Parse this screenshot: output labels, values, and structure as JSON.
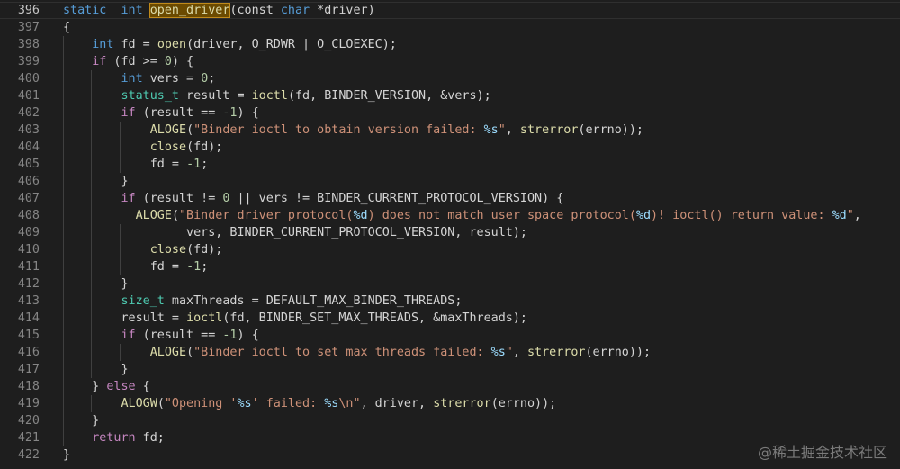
{
  "editor": {
    "current_line": "396",
    "lines": [
      {
        "n": "396",
        "tokens": [
          [
            "kw",
            "static"
          ],
          [
            "",
            "  "
          ],
          [
            "kw",
            "int"
          ],
          [
            "",
            " "
          ],
          [
            "fn hl",
            "open_driver"
          ],
          [
            "",
            "(const "
          ],
          [
            "kw",
            "char"
          ],
          [
            "",
            " *driver)"
          ]
        ]
      },
      {
        "n": "397",
        "tokens": [
          [
            "",
            "{"
          ]
        ]
      },
      {
        "n": "398",
        "tokens": [
          [
            "",
            "    "
          ],
          [
            "kw",
            "int"
          ],
          [
            "",
            " fd = "
          ],
          [
            "fn",
            "open"
          ],
          [
            "",
            "(driver, O_RDWR | O_CLOEXEC);"
          ]
        ]
      },
      {
        "n": "399",
        "tokens": [
          [
            "",
            "    "
          ],
          [
            "ctl",
            "if"
          ],
          [
            "",
            " (fd >= "
          ],
          [
            "num",
            "0"
          ],
          [
            "",
            ") {"
          ]
        ]
      },
      {
        "n": "400",
        "tokens": [
          [
            "",
            "        "
          ],
          [
            "kw",
            "int"
          ],
          [
            "",
            " vers = "
          ],
          [
            "num",
            "0"
          ],
          [
            "",
            ";"
          ]
        ]
      },
      {
        "n": "401",
        "tokens": [
          [
            "",
            "        "
          ],
          [
            "ty",
            "status_t"
          ],
          [
            "",
            " result = "
          ],
          [
            "fn",
            "ioctl"
          ],
          [
            "",
            "(fd, BINDER_VERSION, &vers);"
          ]
        ]
      },
      {
        "n": "402",
        "tokens": [
          [
            "",
            "        "
          ],
          [
            "ctl",
            "if"
          ],
          [
            "",
            " (result == "
          ],
          [
            "num",
            "-1"
          ],
          [
            "",
            ") {"
          ]
        ]
      },
      {
        "n": "403",
        "tokens": [
          [
            "",
            "            "
          ],
          [
            "fn",
            "ALOGE"
          ],
          [
            "",
            "("
          ],
          [
            "str",
            "\"Binder ioctl to obtain version failed: "
          ],
          [
            "fmt",
            "%s"
          ],
          [
            "str",
            "\""
          ],
          [
            "",
            ", "
          ],
          [
            "fn",
            "strerror"
          ],
          [
            "",
            "(errno));"
          ]
        ]
      },
      {
        "n": "404",
        "tokens": [
          [
            "",
            "            "
          ],
          [
            "fn",
            "close"
          ],
          [
            "",
            "(fd);"
          ]
        ]
      },
      {
        "n": "405",
        "tokens": [
          [
            "",
            "            fd = "
          ],
          [
            "num",
            "-1"
          ],
          [
            "",
            ";"
          ]
        ]
      },
      {
        "n": "406",
        "tokens": [
          [
            "",
            "        }"
          ]
        ]
      },
      {
        "n": "407",
        "tokens": [
          [
            "",
            "        "
          ],
          [
            "ctl",
            "if"
          ],
          [
            "",
            " (result != "
          ],
          [
            "num",
            "0"
          ],
          [
            "",
            " || vers != BINDER_CURRENT_PROTOCOL_VERSION) {"
          ]
        ]
      },
      {
        "n": "408",
        "tokens": [
          [
            "",
            "          "
          ],
          [
            "fn",
            "ALOGE"
          ],
          [
            "",
            "("
          ],
          [
            "str",
            "\"Binder driver protocol("
          ],
          [
            "fmt",
            "%d"
          ],
          [
            "str",
            ") does not match user space protocol("
          ],
          [
            "fmt",
            "%d"
          ],
          [
            "str",
            ")! ioctl() return value: "
          ],
          [
            "fmt",
            "%d"
          ],
          [
            "str",
            "\""
          ],
          [
            "",
            ","
          ]
        ]
      },
      {
        "n": "409",
        "tokens": [
          [
            "",
            "                 vers, BINDER_CURRENT_PROTOCOL_VERSION, result);"
          ]
        ]
      },
      {
        "n": "410",
        "tokens": [
          [
            "",
            "            "
          ],
          [
            "fn",
            "close"
          ],
          [
            "",
            "(fd);"
          ]
        ]
      },
      {
        "n": "411",
        "tokens": [
          [
            "",
            "            fd = "
          ],
          [
            "num",
            "-1"
          ],
          [
            "",
            ";"
          ]
        ]
      },
      {
        "n": "412",
        "tokens": [
          [
            "",
            "        }"
          ]
        ]
      },
      {
        "n": "413",
        "tokens": [
          [
            "",
            "        "
          ],
          [
            "ty",
            "size_t"
          ],
          [
            "",
            " maxThreads = DEFAULT_MAX_BINDER_THREADS;"
          ]
        ]
      },
      {
        "n": "414",
        "tokens": [
          [
            "",
            "        result = "
          ],
          [
            "fn",
            "ioctl"
          ],
          [
            "",
            "(fd, BINDER_SET_MAX_THREADS, &maxThreads);"
          ]
        ]
      },
      {
        "n": "415",
        "tokens": [
          [
            "",
            "        "
          ],
          [
            "ctl",
            "if"
          ],
          [
            "",
            " (result == "
          ],
          [
            "num",
            "-1"
          ],
          [
            "",
            ") {"
          ]
        ]
      },
      {
        "n": "416",
        "tokens": [
          [
            "",
            "            "
          ],
          [
            "fn",
            "ALOGE"
          ],
          [
            "",
            "("
          ],
          [
            "str",
            "\"Binder ioctl to set max threads failed: "
          ],
          [
            "fmt",
            "%s"
          ],
          [
            "str",
            "\""
          ],
          [
            "",
            ", "
          ],
          [
            "fn",
            "strerror"
          ],
          [
            "",
            "(errno));"
          ]
        ]
      },
      {
        "n": "417",
        "tokens": [
          [
            "",
            "        }"
          ]
        ]
      },
      {
        "n": "418",
        "tokens": [
          [
            "",
            "    } "
          ],
          [
            "ctl",
            "else"
          ],
          [
            "",
            " {"
          ]
        ]
      },
      {
        "n": "419",
        "tokens": [
          [
            "",
            "        "
          ],
          [
            "fn",
            "ALOGW"
          ],
          [
            "",
            "("
          ],
          [
            "str",
            "\"Opening '"
          ],
          [
            "fmt",
            "%s"
          ],
          [
            "str",
            "' failed: "
          ],
          [
            "fmt",
            "%s"
          ],
          [
            "str",
            "\\n\""
          ],
          [
            "",
            ", driver, "
          ],
          [
            "fn",
            "strerror"
          ],
          [
            "",
            "(errno));"
          ]
        ]
      },
      {
        "n": "420",
        "tokens": [
          [
            "",
            "    }"
          ]
        ]
      },
      {
        "n": "421",
        "tokens": [
          [
            "",
            "    "
          ],
          [
            "ctl",
            "return"
          ],
          [
            "",
            " fd;"
          ]
        ]
      },
      {
        "n": "422",
        "tokens": [
          [
            "",
            "}"
          ]
        ]
      }
    ]
  },
  "watermark": "@稀土掘金技术社区"
}
